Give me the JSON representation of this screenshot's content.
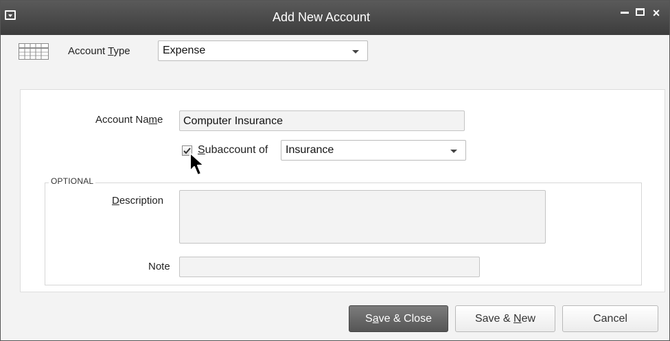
{
  "window": {
    "title": "Add New Account"
  },
  "account_type": {
    "label_pre": "Account ",
    "label_ul": "T",
    "label_post": "ype",
    "value": "Expense"
  },
  "account_name": {
    "label_pre": "Account Na",
    "label_ul": "m",
    "label_post": "e",
    "value": "Computer Insurance"
  },
  "subaccount": {
    "checked": true,
    "label_ul": "S",
    "label_post": "ubaccount of",
    "value": "Insurance"
  },
  "optional": {
    "legend": "OPTIONAL",
    "description_ul": "D",
    "description_post": "escription",
    "description_value": "",
    "note_label": "Note",
    "note_value": ""
  },
  "buttons": {
    "save_close_pre": "S",
    "save_close_ul": "a",
    "save_close_post": "ve & Close",
    "save_new_pre": "Save & ",
    "save_new_ul": "N",
    "save_new_post": "ew",
    "cancel": "Cancel"
  },
  "icons": {
    "account_type_icon": "ledger-icon",
    "window_menu": "system-menu-icon",
    "minimize": "minimize-icon",
    "maximize": "maximize-icon",
    "close": "close-icon",
    "cursor": "mouse-pointer-icon"
  },
  "colors": {
    "titlebar": "#474747",
    "primary_button": "#666666",
    "panel_bg": "#ffffff",
    "window_bg": "#f3f3f3"
  }
}
